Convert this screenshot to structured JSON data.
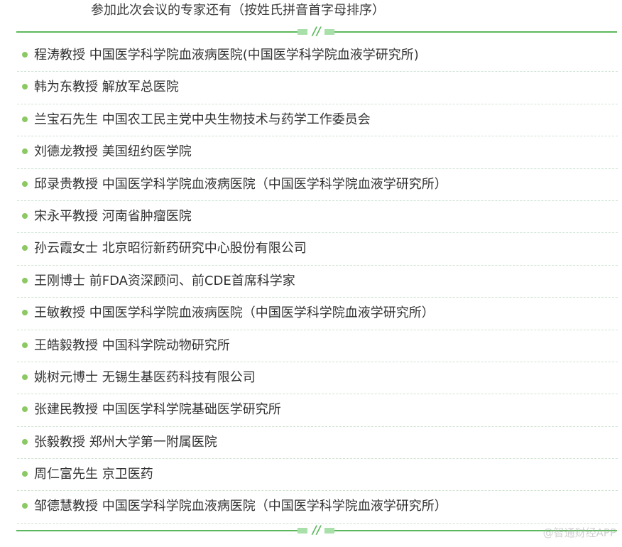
{
  "intro": "参加此次会议的专家还有（按姓氏拼音首字母排序）",
  "divider_symbol": "//",
  "experts": [
    "程涛教授 中国医学科学院血液病医院(中国医学科学院血液学研究所)",
    "韩为东教授 解放军总医院",
    "兰宝石先生 中国农工民主党中央生物技术与药学工作委员会",
    "刘德龙教授 美国纽约医学院",
    "邱录贵教授 中国医学科学院血液病医院（中国医学科学院血液学研究所）",
    "宋永平教授  河南省肿瘤医院",
    "孙云霞女士 北京昭衍新药研究中心股份有限公司",
    "王刚博士  前FDA资深顾问、前CDE首席科学家",
    "王敏教授  中国医学科学院血液病医院（中国医学科学院血液学研究所）",
    "王皓毅教授 中国科学院动物研究所",
    "姚树元博士  无锡生基医药科技有限公司",
    "张建民教授 中国医学科学院基础医学研究所",
    "张毅教授  郑州大学第一附属医院",
    "周仁富先生 京卫医药",
    "邹德慧教授 中国医学科学院血液病医院（中国医学科学院血液学研究所）"
  ],
  "watermark": "@智通财经APP",
  "colors": {
    "accent": "#5cb85c",
    "bullet": "#8cc863",
    "text": "#333333"
  }
}
